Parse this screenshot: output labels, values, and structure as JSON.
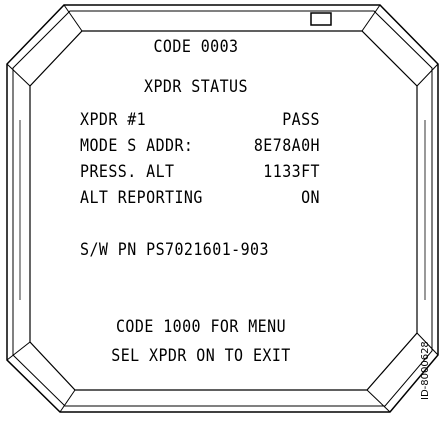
{
  "display": {
    "title_line1": "CODE 0003",
    "title_line2": "XPDR STATUS",
    "rows": [
      {
        "label": "XPDR #1",
        "value": "PASS"
      },
      {
        "label": "MODE S ADDR:",
        "value": "8E78A0H"
      },
      {
        "label": "PRESS. ALT",
        "value": "1133FT"
      },
      {
        "label": "ALT REPORTING",
        "value": "ON"
      }
    ],
    "part_number": "S/W PN PS7021601-903",
    "footer_line1": "CODE 1000 FOR MENU",
    "footer_line2": "SEL XPDR ON TO EXIT"
  },
  "figure_id": "ID-8000628",
  "colors": {
    "ink": "#000000",
    "background": "#ffffff"
  },
  "icons": {
    "indicator": "annunciator-box-icon"
  }
}
